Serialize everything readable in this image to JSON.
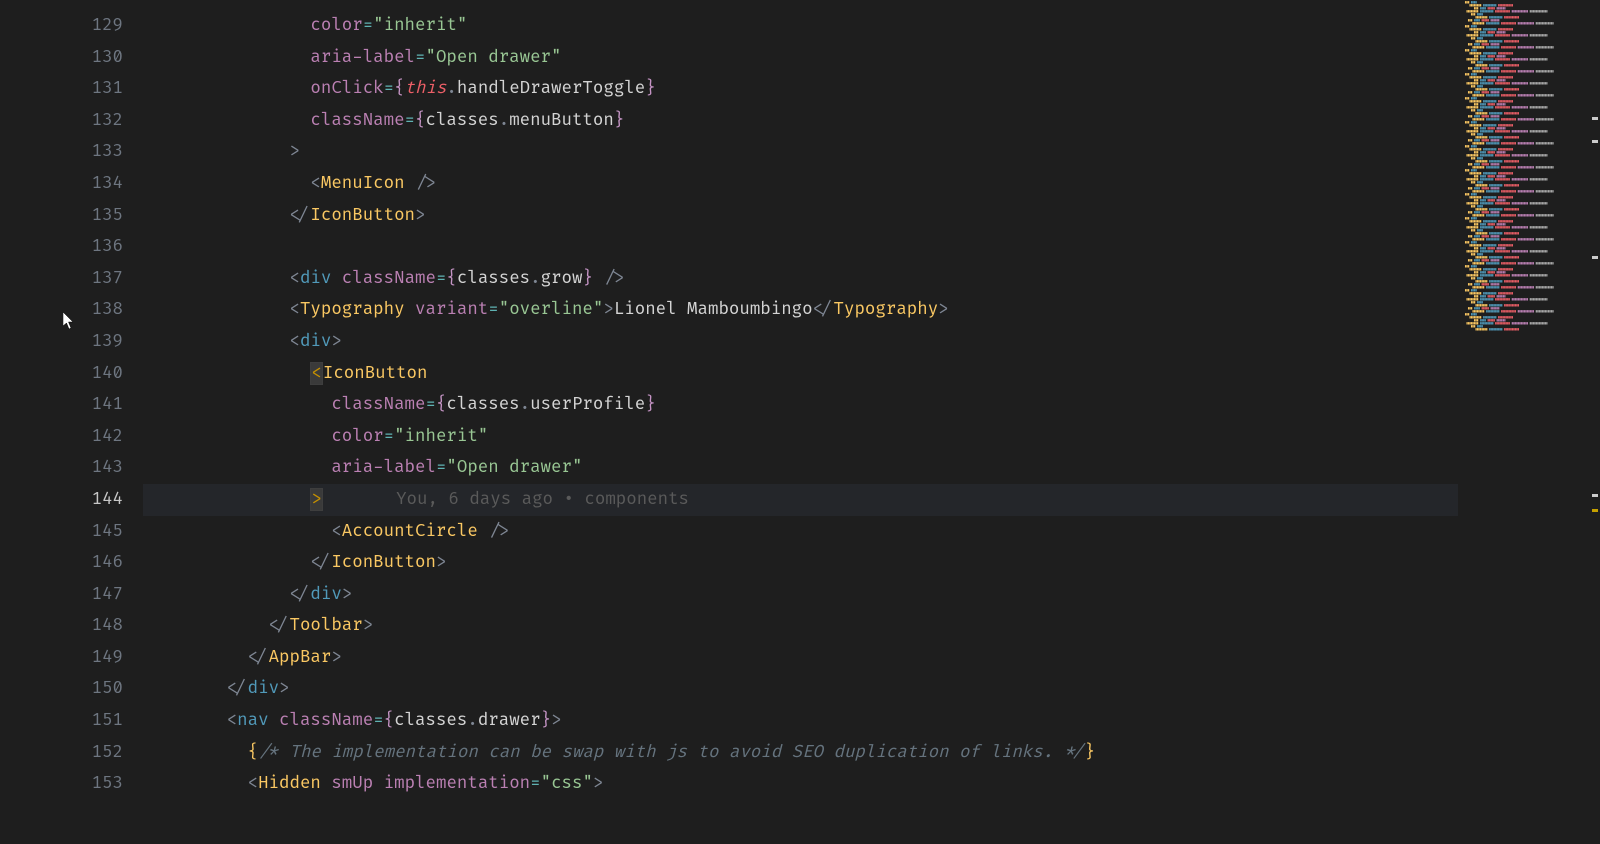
{
  "editor": {
    "first_line_number": 129,
    "active_line_number": 144,
    "blame": "You, 6 days ago • components",
    "lines": {
      "l129": {
        "indent": 16,
        "tokens": [
          [
            "attr",
            "color"
          ],
          [
            "op",
            "="
          ],
          [
            "str",
            "\"inherit\""
          ]
        ]
      },
      "l130": {
        "indent": 16,
        "tokens": [
          [
            "attr",
            "aria-label"
          ],
          [
            "op",
            "="
          ],
          [
            "str",
            "\"Open drawer\""
          ]
        ]
      },
      "l131": {
        "indent": 16,
        "tokens": [
          [
            "attr",
            "onClick"
          ],
          [
            "op",
            "="
          ],
          [
            "brace",
            "{"
          ],
          [
            "kw",
            "this"
          ],
          [
            "pnc",
            "."
          ],
          [
            "var",
            "handleDrawerToggle"
          ],
          [
            "brace",
            "}"
          ]
        ]
      },
      "l132": {
        "indent": 16,
        "tokens": [
          [
            "attr",
            "className"
          ],
          [
            "op",
            "="
          ],
          [
            "brace",
            "{"
          ],
          [
            "var",
            "classes"
          ],
          [
            "pnc",
            "."
          ],
          [
            "var",
            "menuButton"
          ],
          [
            "brace",
            "}"
          ]
        ]
      },
      "l133": {
        "indent": 14,
        "tokens": [
          [
            "pnc",
            ">"
          ]
        ]
      },
      "l134": {
        "indent": 16,
        "tokens": [
          [
            "pnc",
            "<"
          ],
          [
            "comp",
            "MenuIcon"
          ],
          [
            "pnc",
            " />"
          ]
        ]
      },
      "l135": {
        "indent": 14,
        "tokens": [
          [
            "pnc",
            "</"
          ],
          [
            "comp",
            "IconButton"
          ],
          [
            "pnc",
            ">"
          ]
        ]
      },
      "l136": {
        "indent": 0,
        "tokens": []
      },
      "l137": {
        "indent": 14,
        "tokens": [
          [
            "pnc",
            "<"
          ],
          [
            "el",
            "div"
          ],
          [
            "pnc",
            " "
          ],
          [
            "attr",
            "className"
          ],
          [
            "op",
            "="
          ],
          [
            "brace",
            "{"
          ],
          [
            "var",
            "classes"
          ],
          [
            "pnc",
            "."
          ],
          [
            "var",
            "grow"
          ],
          [
            "brace",
            "}"
          ],
          [
            "pnc",
            " />"
          ]
        ]
      },
      "l138": {
        "indent": 14,
        "tokens": [
          [
            "pnc",
            "<"
          ],
          [
            "comp",
            "Typography"
          ],
          [
            "pnc",
            " "
          ],
          [
            "attr",
            "variant"
          ],
          [
            "op",
            "="
          ],
          [
            "str",
            "\"overline\""
          ],
          [
            "pnc",
            ">"
          ],
          [
            "var",
            "Lionel Mamboumbingo"
          ],
          [
            "pnc",
            "</"
          ],
          [
            "comp",
            "Typography"
          ],
          [
            "pnc",
            ">"
          ]
        ]
      },
      "l139": {
        "indent": 14,
        "tokens": [
          [
            "pnc",
            "<"
          ],
          [
            "el",
            "div"
          ],
          [
            "pnc",
            ">"
          ]
        ]
      },
      "l140": {
        "indent": 16,
        "tokens": [
          [
            "bracket-match",
            "<"
          ],
          [
            "comp",
            "IconButton"
          ]
        ]
      },
      "l141": {
        "indent": 18,
        "tokens": [
          [
            "attr",
            "className"
          ],
          [
            "op",
            "="
          ],
          [
            "brace",
            "{"
          ],
          [
            "var",
            "classes"
          ],
          [
            "pnc",
            "."
          ],
          [
            "var",
            "userProfile"
          ],
          [
            "brace",
            "}"
          ]
        ]
      },
      "l142": {
        "indent": 18,
        "tokens": [
          [
            "attr",
            "color"
          ],
          [
            "op",
            "="
          ],
          [
            "str",
            "\"inherit\""
          ]
        ]
      },
      "l143": {
        "indent": 18,
        "tokens": [
          [
            "attr",
            "aria-label"
          ],
          [
            "op",
            "="
          ],
          [
            "str",
            "\"Open drawer\""
          ]
        ]
      },
      "l144": {
        "indent": 16,
        "tokens": [
          [
            "bracket-match",
            ">"
          ]
        ],
        "blame_after": true
      },
      "l145": {
        "indent": 18,
        "tokens": [
          [
            "pnc",
            "<"
          ],
          [
            "comp",
            "AccountCircle"
          ],
          [
            "pnc",
            " />"
          ]
        ]
      },
      "l146": {
        "indent": 16,
        "tokens": [
          [
            "pnc",
            "</"
          ],
          [
            "comp",
            "IconButton"
          ],
          [
            "pnc",
            ">"
          ]
        ]
      },
      "l147": {
        "indent": 14,
        "tokens": [
          [
            "pnc",
            "</"
          ],
          [
            "el",
            "div"
          ],
          [
            "pnc",
            ">"
          ]
        ]
      },
      "l148": {
        "indent": 12,
        "tokens": [
          [
            "pnc",
            "</"
          ],
          [
            "comp",
            "Toolbar"
          ],
          [
            "pnc",
            ">"
          ]
        ]
      },
      "l149": {
        "indent": 10,
        "tokens": [
          [
            "pnc",
            "</"
          ],
          [
            "comp",
            "AppBar"
          ],
          [
            "pnc",
            ">"
          ]
        ]
      },
      "l150": {
        "indent": 8,
        "tokens": [
          [
            "pnc",
            "</"
          ],
          [
            "el",
            "div"
          ],
          [
            "pnc",
            ">"
          ]
        ]
      },
      "l151": {
        "indent": 8,
        "tokens": [
          [
            "pnc",
            "<"
          ],
          [
            "el",
            "nav"
          ],
          [
            "pnc",
            " "
          ],
          [
            "attr",
            "className"
          ],
          [
            "op",
            "="
          ],
          [
            "brace",
            "{"
          ],
          [
            "var",
            "classes"
          ],
          [
            "pnc",
            "."
          ],
          [
            "var",
            "drawer"
          ],
          [
            "brace",
            "}"
          ],
          [
            "pnc",
            ">"
          ]
        ]
      },
      "l152": {
        "indent": 10,
        "tokens": [
          [
            "br2",
            "{"
          ],
          [
            "cm",
            "/* The implementation can be swap with js to avoid SEO duplication of links. */"
          ],
          [
            "br2",
            "}"
          ]
        ]
      },
      "l153": {
        "indent": 10,
        "tokens": [
          [
            "pnc",
            "<"
          ],
          [
            "comp",
            "Hidden"
          ],
          [
            "pnc",
            " "
          ],
          [
            "attr",
            "smUp"
          ],
          [
            "pnc",
            " "
          ],
          [
            "attr",
            "implementation"
          ],
          [
            "op",
            "="
          ],
          [
            "str",
            "\"css\""
          ],
          [
            "pnc",
            ">"
          ]
        ]
      }
    }
  }
}
